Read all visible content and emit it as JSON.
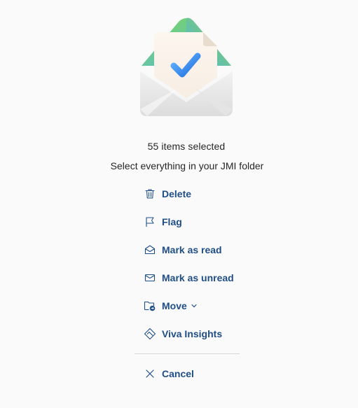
{
  "selection": {
    "count_text": "55 items selected",
    "select_all_text": "Select everything in your JMI folder"
  },
  "actions": [
    {
      "label": "Delete",
      "icon": "trash-icon"
    },
    {
      "label": "Flag",
      "icon": "flag-icon"
    },
    {
      "label": "Mark as read",
      "icon": "envelope-open-icon"
    },
    {
      "label": "Mark as unread",
      "icon": "envelope-icon"
    },
    {
      "label": "Move",
      "icon": "folder-move-icon"
    },
    {
      "label": "Viva Insights",
      "icon": "viva-insights-icon"
    }
  ],
  "cancel": {
    "label": "Cancel",
    "icon": "close-icon"
  },
  "colors": {
    "accent": "#1f4e87",
    "text": "#262626",
    "background": "#fafafa"
  }
}
